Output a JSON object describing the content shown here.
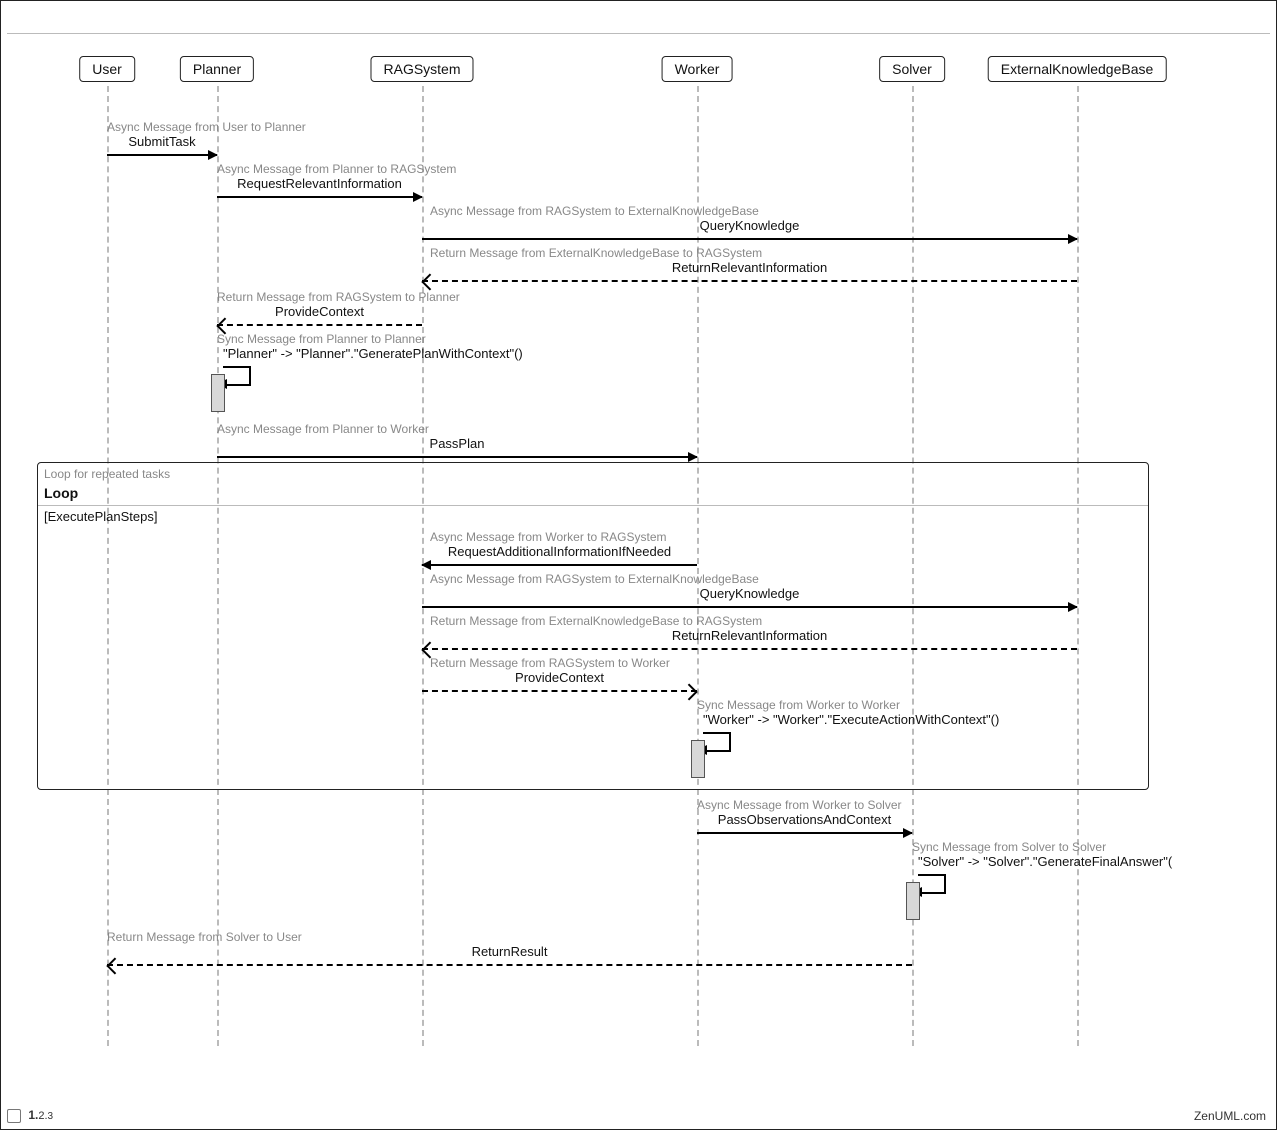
{
  "participants": {
    "user": "User",
    "planner": "Planner",
    "rag": "RAGSystem",
    "worker": "Worker",
    "solver": "Solver",
    "ekb": "ExternalKnowledgeBase"
  },
  "messages": {
    "m1": {
      "desc": "Async Message from User to Planner",
      "label": "SubmitTask"
    },
    "m2": {
      "desc": "Async Message from Planner to RAGSystem",
      "label": "RequestRelevantInformation"
    },
    "m3": {
      "desc": "Async Message from RAGSystem to ExternalKnowledgeBase",
      "label": "QueryKnowledge"
    },
    "m4": {
      "desc": "Return Message from ExternalKnowledgeBase to RAGSystem",
      "label": "ReturnRelevantInformation"
    },
    "m5": {
      "desc": "Return Message from RAGSystem to Planner",
      "label": "ProvideContext"
    },
    "m6": {
      "desc": "Sync Message from Planner to Planner",
      "label": "\"Planner\" -> \"Planner\".\"GeneratePlanWithContext\"()"
    },
    "m7": {
      "desc": "Async Message from Planner to Worker",
      "label": "PassPlan"
    },
    "m8": {
      "desc": "Async Message from Worker to RAGSystem",
      "label": "RequestAdditionalInformationIfNeeded"
    },
    "m9": {
      "desc": "Async Message from RAGSystem to ExternalKnowledgeBase",
      "label": "QueryKnowledge"
    },
    "m10": {
      "desc": "Return Message from ExternalKnowledgeBase to RAGSystem",
      "label": "ReturnRelevantInformation"
    },
    "m11": {
      "desc": "Return Message from RAGSystem to Worker",
      "label": "ProvideContext"
    },
    "m12": {
      "desc": "Sync Message from Worker to Worker",
      "label": "\"Worker\" -> \"Worker\".\"ExecuteActionWithContext\"()"
    },
    "m13": {
      "desc": "Async Message from Worker to Solver",
      "label": "PassObservationsAndContext"
    },
    "m14": {
      "desc": "Sync Message from Solver to Solver",
      "label": "\"Solver\" -> \"Solver\".\"GenerateFinalAnswer\"("
    },
    "m15": {
      "desc": "Return Message from Solver to User",
      "label": "ReturnResult"
    }
  },
  "fragment": {
    "desc": "Loop for repeated tasks",
    "title": "Loop",
    "condition": "[ExecutePlanSteps]"
  },
  "footer": {
    "version_major": "1.",
    "version_minor": "2.",
    "version_patch": "3",
    "brand": "ZenUML.com"
  },
  "layout": {
    "x": {
      "user": 100,
      "planner": 210,
      "rag": 415,
      "worker": 690,
      "solver": 905,
      "ekb": 1070
    }
  }
}
